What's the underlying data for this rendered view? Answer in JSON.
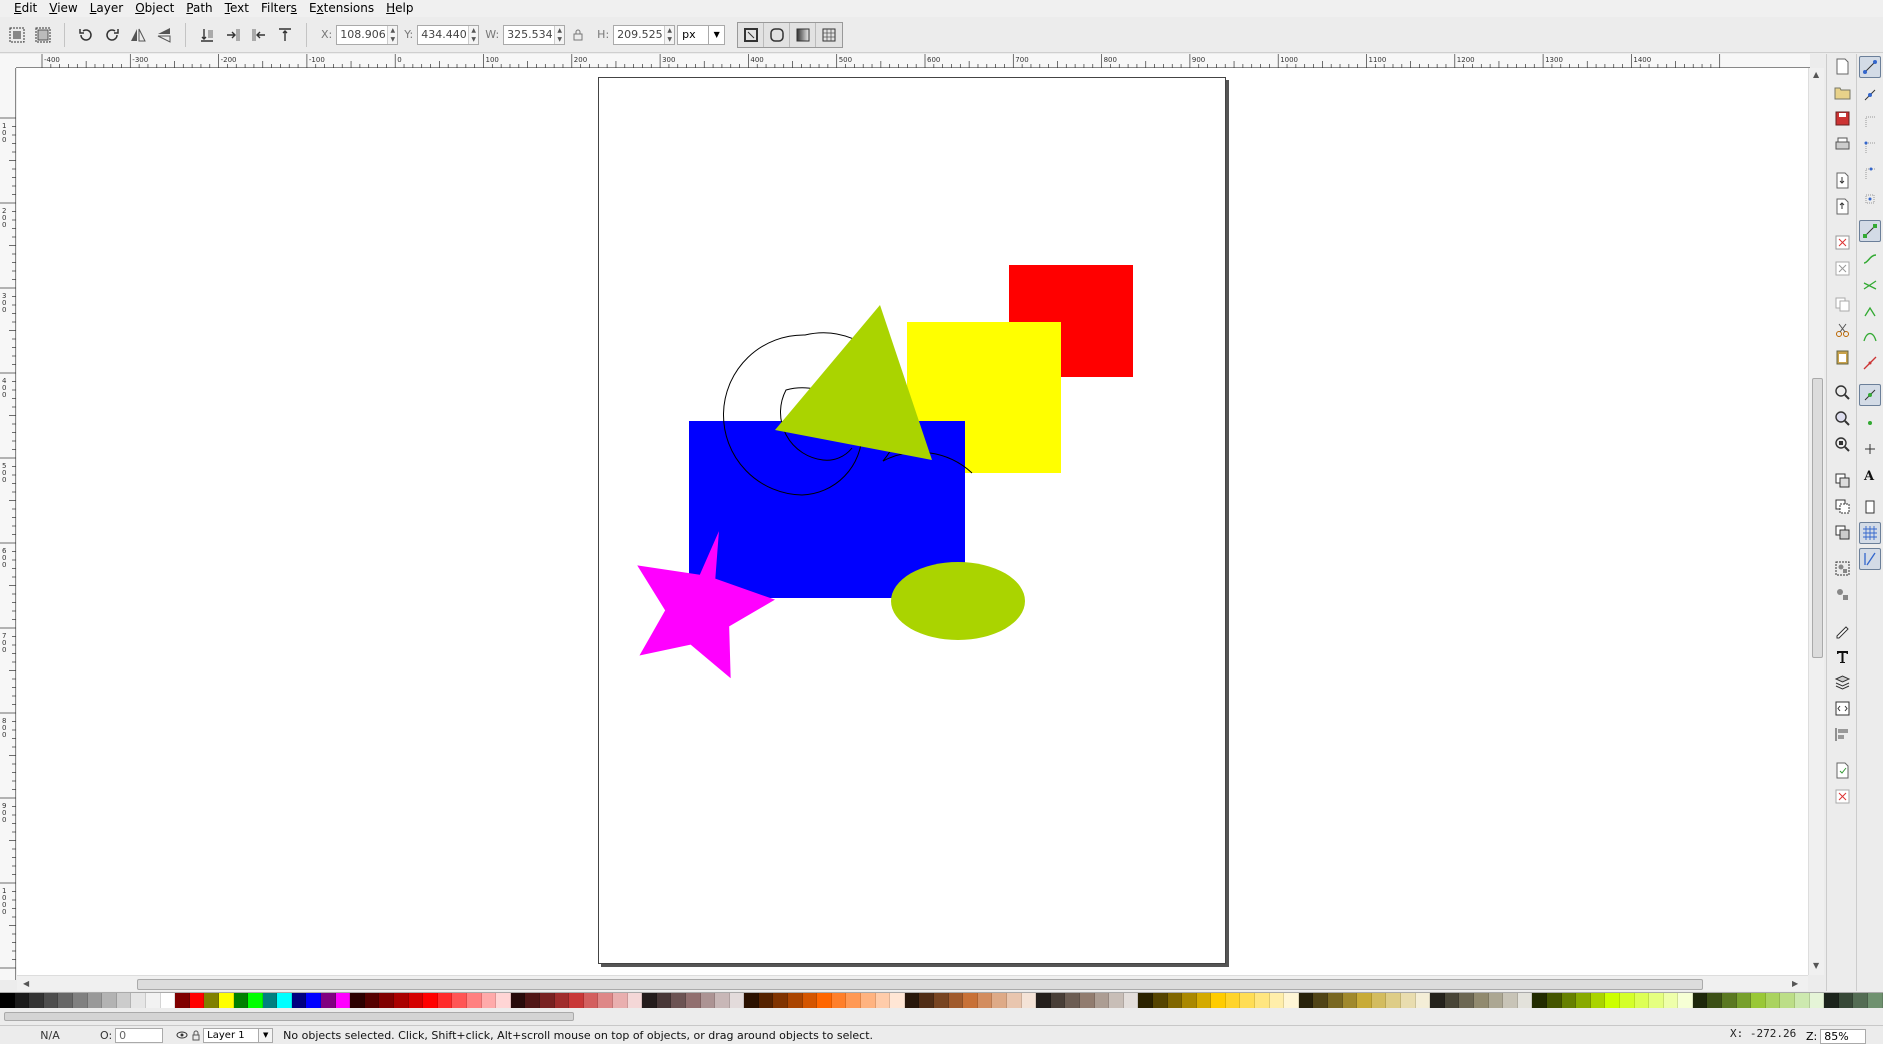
{
  "menu": {
    "items": [
      {
        "pre": "",
        "u": "E",
        "post": "dit"
      },
      {
        "pre": "",
        "u": "V",
        "post": "iew"
      },
      {
        "pre": "",
        "u": "L",
        "post": "ayer"
      },
      {
        "pre": "",
        "u": "O",
        "post": "bject"
      },
      {
        "pre": "",
        "u": "P",
        "post": "ath"
      },
      {
        "pre": "",
        "u": "T",
        "post": "ext"
      },
      {
        "pre": "Filter",
        "u": "s",
        "post": ""
      },
      {
        "pre": "E",
        "u": "x",
        "post": "tensions"
      },
      {
        "pre": "",
        "u": "H",
        "post": "elp"
      }
    ]
  },
  "toolbar": {
    "x_label": "X:",
    "x_value": "108.906",
    "y_label": "Y:",
    "y_value": "434.440",
    "w_label": "W:",
    "w_value": "325.534",
    "h_label": "H:",
    "h_value": "209.525",
    "unit": "px"
  },
  "rulers": {
    "h_labels": [
      "-400",
      "-300",
      "-200",
      "-100",
      "0",
      "100",
      "200",
      "300",
      "400",
      "500",
      "600",
      "700",
      "800",
      "900",
      "1000",
      "1100",
      "1200",
      "1300",
      "1400"
    ],
    "v_labels": [
      "100",
      "200",
      "300",
      "400",
      "500",
      "600",
      "700",
      "800",
      "900",
      "1000"
    ]
  },
  "statusbar": {
    "fill": "N/A",
    "opacity_label": "O:",
    "opacity_value": "0",
    "layer": "Layer 1",
    "message": "No objects selected. Click, Shift+click, Alt+scroll mouse on top of objects, or drag around objects to select.",
    "coords": "X: -272.26",
    "zoom_label": "Z:",
    "zoom_value": "85%"
  },
  "palette": [
    "#000000",
    "#1a1a1a",
    "#333333",
    "#4d4d4d",
    "#666666",
    "#808080",
    "#999999",
    "#b3b3b3",
    "#cccccc",
    "#e6e6e6",
    "#f2f2f2",
    "#ffffff",
    "#800000",
    "#ff0000",
    "#808000",
    "#ffff00",
    "#008000",
    "#00ff00",
    "#008080",
    "#00ffff",
    "#000080",
    "#0000ff",
    "#800080",
    "#ff00ff",
    "#2b0000",
    "#550000",
    "#800000",
    "#aa0000",
    "#d40000",
    "#ff0000",
    "#ff2a2a",
    "#ff5555",
    "#ff8080",
    "#ffaaaa",
    "#ffd5d5",
    "#280b0b",
    "#501616",
    "#782121",
    "#a02c2c",
    "#c83737",
    "#d35f5f",
    "#de8787",
    "#e9afaf",
    "#f4d7d7",
    "#241c1c",
    "#483737",
    "#6c5353",
    "#916f6f",
    "#ac9393",
    "#c8b7b7",
    "#e3dbdb",
    "#2b1100",
    "#552200",
    "#803300",
    "#aa4400",
    "#d45500",
    "#ff6600",
    "#ff7f2a",
    "#ff9955",
    "#ffb380",
    "#ffccaa",
    "#ffe6d5",
    "#28170b",
    "#502d16",
    "#784421",
    "#a05a2c",
    "#c87137",
    "#d38d5f",
    "#deaa87",
    "#e9c6af",
    "#f4e3d7",
    "#241f1c",
    "#483e37",
    "#6c5d53",
    "#917c6f",
    "#ac9d93",
    "#c8beb7",
    "#e3dedb",
    "#2b2200",
    "#554400",
    "#806600",
    "#aa8800",
    "#d4aa00",
    "#ffcc00",
    "#ffd42a",
    "#ffdd55",
    "#ffe680",
    "#ffeeaa",
    "#fff6d5",
    "#28220b",
    "#504416",
    "#786721",
    "#a0892c",
    "#c8ab37",
    "#d3bc5f",
    "#decd87",
    "#e9ddaf",
    "#f4eed7",
    "#24221c",
    "#484537",
    "#6c6753",
    "#918a6f",
    "#aca793",
    "#c8c4b7",
    "#e3e2db",
    "#222b00",
    "#445500",
    "#668000",
    "#88aa00",
    "#aad400",
    "#ccff00",
    "#d4ff2a",
    "#ddff55",
    "#e5ff80",
    "#eeffaa",
    "#f6ffd5",
    "#1e280b",
    "#3c5016",
    "#5a7821",
    "#77a02c",
    "#99c837",
    "#aad35f",
    "#bcde87",
    "#cde9af",
    "#e5f4d7",
    "#1c241c",
    "#374837",
    "#536c53",
    "#6f916f"
  ]
}
